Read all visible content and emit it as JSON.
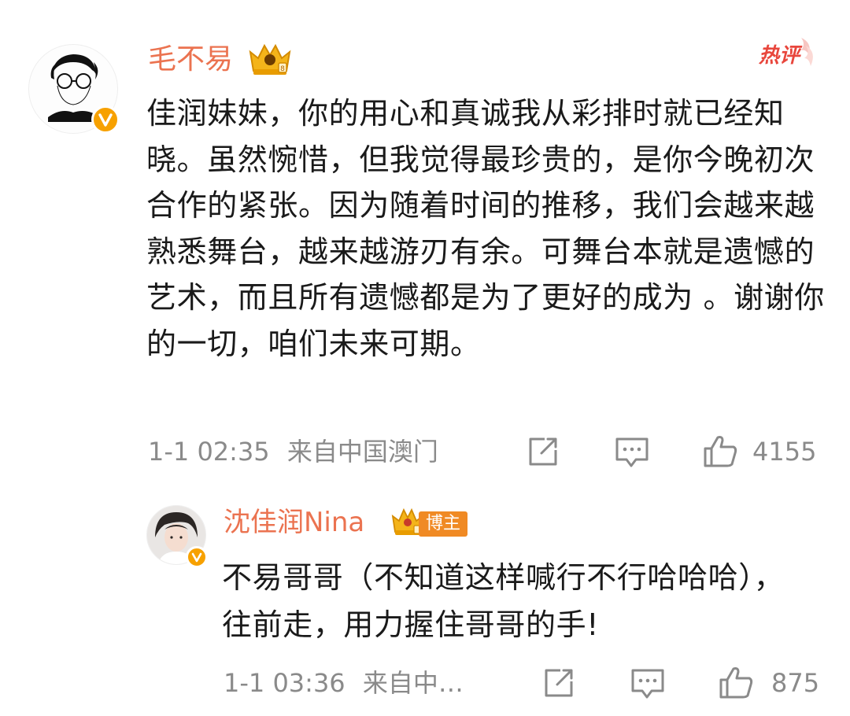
{
  "colors": {
    "username": "#eb7350",
    "meta": "#8a8a8a",
    "text": "#1a1a1a",
    "hot": "#e8463c",
    "verified": "#f7a100",
    "host_tag": "#f08a24"
  },
  "main_comment": {
    "username": "毛不易",
    "hot_label": "热评",
    "text": "佳润妹妹，你的用心和真诚我从彩排时就已经知晓。虽然惋惜，但我觉得最珍贵的，是你今晚初次合作的紧张。因为随着时间的推移，我们会越来越熟悉舞台，越来越游刃有余。可舞台本就是遗憾的艺术，而且所有遗憾都是为了更好的成为 。谢谢你的一切，咱们未来可期。",
    "timestamp": "1-1 02:35",
    "location": "来自中国澳门",
    "like_count": "4155",
    "icons": [
      "avatar",
      "verified-v-icon",
      "crown-badge-icon",
      "hot-comment-icon",
      "share-icon",
      "reply-icon",
      "like-icon"
    ]
  },
  "reply_comment": {
    "username": "沈佳润Nina",
    "host_label": "博主",
    "text": "不易哥哥（不知道这样喊行不行哈哈哈），往前走，用力握住哥哥的手!",
    "timestamp": "1-1 03:36",
    "location": "来自中…",
    "like_count": "875",
    "icons": [
      "avatar",
      "verified-v-icon",
      "crown-badge-icon",
      "share-icon",
      "reply-icon",
      "like-icon"
    ]
  }
}
